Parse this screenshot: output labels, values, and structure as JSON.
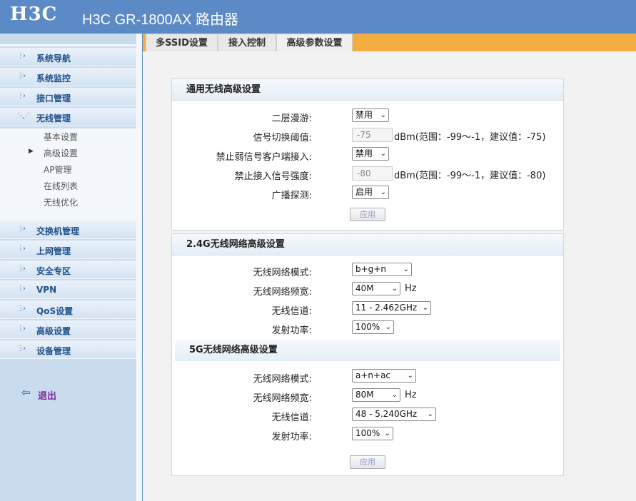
{
  "header": {
    "logo": "H3C",
    "title": "H3C GR-1800AX 路由器"
  },
  "tabs": [
    {
      "label": "多SSID设置"
    },
    {
      "label": "接入控制"
    },
    {
      "label": "高级参数设置"
    }
  ],
  "sidebar": {
    "items": [
      {
        "label": "系统导航"
      },
      {
        "label": "系统监控"
      },
      {
        "label": "接口管理"
      },
      {
        "label": "无线管理"
      },
      {
        "label": "交换机管理"
      },
      {
        "label": "上网管理"
      },
      {
        "label": "安全专区"
      },
      {
        "label": "VPN"
      },
      {
        "label": "QoS设置"
      },
      {
        "label": "高级设置"
      },
      {
        "label": "设备管理"
      }
    ],
    "submenu": [
      {
        "label": "基本设置"
      },
      {
        "label": "高级设置",
        "active": true
      },
      {
        "label": "AP管理"
      },
      {
        "label": "在线列表"
      },
      {
        "label": "无线优化"
      }
    ],
    "logout": "退出"
  },
  "general": {
    "title": "通用无线高级设置",
    "roaming_label": "二层漫游:",
    "roaming_value": "禁用",
    "switch_threshold_label": "信号切换阈值:",
    "switch_threshold_value": "-75",
    "switch_threshold_hint": "dBm(范围：-99～-1，建议值：-75)",
    "weak_client_label": "禁止弱信号客户端接入:",
    "weak_client_value": "禁用",
    "access_strength_label": "禁止接入信号强度:",
    "access_strength_value": "-80",
    "access_strength_hint": "dBm(范围：-99～-1，建议值：-80)",
    "broadcast_probe_label": "广播探测:",
    "broadcast_probe_value": "启用",
    "apply": "应用"
  },
  "band24": {
    "title": "2.4G无线网络高级设置",
    "mode_label": "无线网络模式:",
    "mode_value": "b+g+n",
    "bandwidth_label": "无线网络频宽:",
    "bandwidth_value": "40M",
    "bandwidth_unit": "Hz",
    "channel_label": "无线信道:",
    "channel_value": "11 - 2.462GHz",
    "power_label": "发射功率:",
    "power_value": "100%"
  },
  "band5": {
    "title": "5G无线网络高级设置",
    "mode_label": "无线网络模式:",
    "mode_value": "a+n+ac",
    "bandwidth_label": "无线网络频宽:",
    "bandwidth_value": "80M",
    "bandwidth_unit": "Hz",
    "channel_label": "无线信道:",
    "channel_value": "48 - 5.240GHz",
    "power_label": "发射功率:",
    "power_value": "100%",
    "apply": "应用"
  }
}
